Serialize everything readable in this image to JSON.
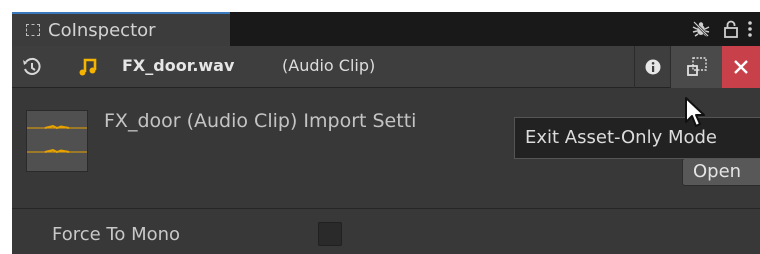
{
  "window": {
    "tab_title": "CoInspector"
  },
  "icons": {
    "tab": "inspector-icon",
    "bug": "debug-bug-icon",
    "lock": "lock-icon",
    "menu": "kebab-menu-icon",
    "history": "history-icon",
    "asset": "audio-clip-icon",
    "info": "info-icon",
    "asset_only": "asset-only-mode-icon",
    "close": "close-icon",
    "thumbnail": "waveform-thumbnail",
    "cursor": "mouse-cursor"
  },
  "header": {
    "file_name": "FX_door.wav",
    "file_type": "(Audio Clip)"
  },
  "import": {
    "title": "FX_door (Audio Clip) Import Setti",
    "open_label": "Open"
  },
  "tooltip": {
    "text": "Exit Asset-Only Mode"
  },
  "settings": {
    "force_to_mono": {
      "label": "Force To Mono",
      "checked": false
    }
  },
  "colors": {
    "panel_bg": "#383838",
    "tab_accent": "#3a79bb",
    "audio_icon": "#f4b400",
    "close_bg": "#c8404a",
    "waveform": "#e8a200"
  }
}
